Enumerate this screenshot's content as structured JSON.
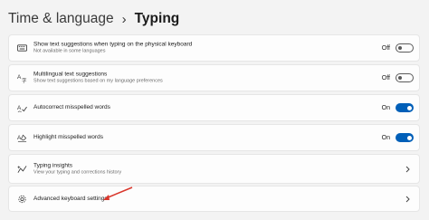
{
  "breadcrumb": {
    "parent": "Time & language",
    "separator": "›",
    "current": "Typing"
  },
  "settings": [
    {
      "icon": "keyboard-icon",
      "title": "Show text suggestions when typing on the physical keyboard",
      "subtitle": "Not available in some languages",
      "control": "toggle",
      "state_label": "Off",
      "on": false
    },
    {
      "icon": "multilingual-icon",
      "title": "Multilingual text suggestions",
      "subtitle": "Show text suggestions based on my language preferences",
      "control": "toggle",
      "state_label": "Off",
      "on": false
    },
    {
      "icon": "autocorrect-icon",
      "title": "Autocorrect misspelled words",
      "subtitle": "",
      "control": "toggle",
      "state_label": "On",
      "on": true
    },
    {
      "icon": "highlight-icon",
      "title": "Highlight misspelled words",
      "subtitle": "",
      "control": "toggle",
      "state_label": "On",
      "on": true
    },
    {
      "icon": "insights-icon",
      "title": "Typing insights",
      "subtitle": "View your typing and corrections history",
      "control": "chevron"
    },
    {
      "icon": "gear-icon",
      "title": "Advanced keyboard settings",
      "subtitle": "",
      "control": "chevron"
    }
  ],
  "colors": {
    "accent": "#005fb8",
    "annotation_arrow": "#d9362b"
  }
}
